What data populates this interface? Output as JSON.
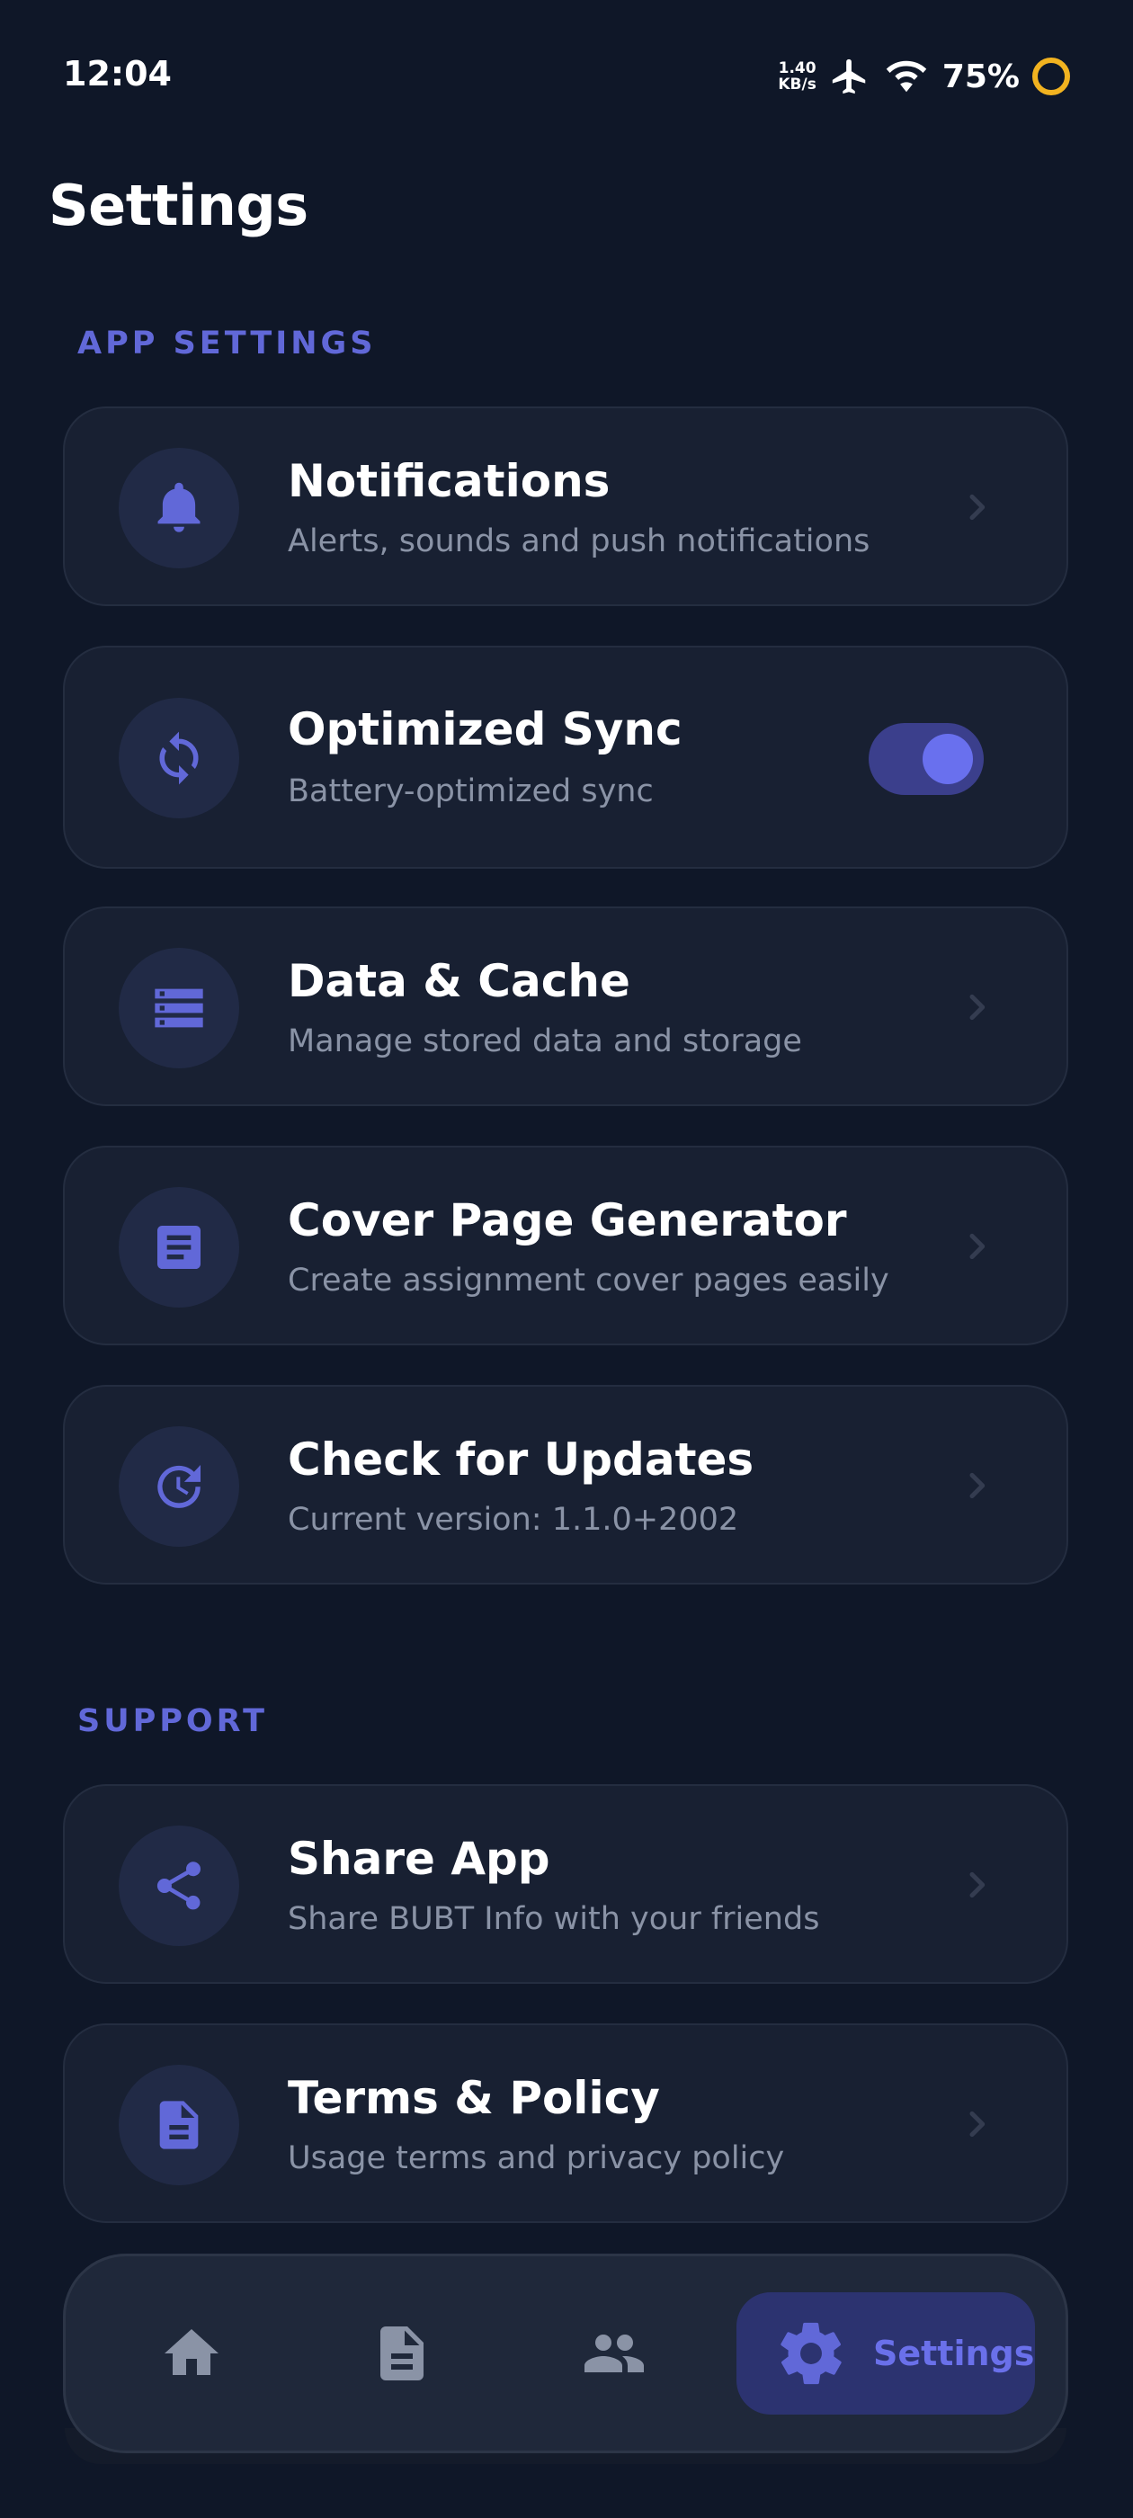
{
  "status_bar": {
    "time": "12:04",
    "net_speed_value": "1.40",
    "net_speed_unit": "KB/s",
    "battery": "75%"
  },
  "page": {
    "title": "Settings"
  },
  "sections": [
    {
      "label": "APP SETTINGS"
    },
    {
      "label": "SUPPORT"
    }
  ],
  "items": [
    {
      "title": "Notifications",
      "subtitle": "Alerts, sounds and push notifications",
      "icon": "bell-icon"
    },
    {
      "title": "Optimized Sync",
      "subtitle": "Battery-optimized sync",
      "icon": "sync-icon",
      "toggle_on": true
    },
    {
      "title": "Data & Cache",
      "subtitle": "Manage stored data and storage",
      "icon": "storage-icon"
    },
    {
      "title": "Cover Page Generator",
      "subtitle": "Create assignment cover pages easily",
      "icon": "article-icon"
    },
    {
      "title": "Check for Updates",
      "subtitle": "Current version: 1.1.0+2002",
      "icon": "update-icon"
    },
    {
      "title": "Share App",
      "subtitle": "Share BUBT Info with your friends",
      "icon": "share-icon"
    },
    {
      "title": "Terms & Policy",
      "subtitle": "Usage terms and privacy policy",
      "icon": "document-icon"
    }
  ],
  "bottom_nav": {
    "items": [
      {
        "icon": "home-icon"
      },
      {
        "icon": "document-icon"
      },
      {
        "icon": "people-icon"
      },
      {
        "icon": "gear-icon",
        "label": "Settings",
        "active": true
      }
    ]
  },
  "colors": {
    "background": "#0f1728",
    "card": "#182032",
    "accent": "#6168d8",
    "subtitle": "#8a93a6"
  }
}
